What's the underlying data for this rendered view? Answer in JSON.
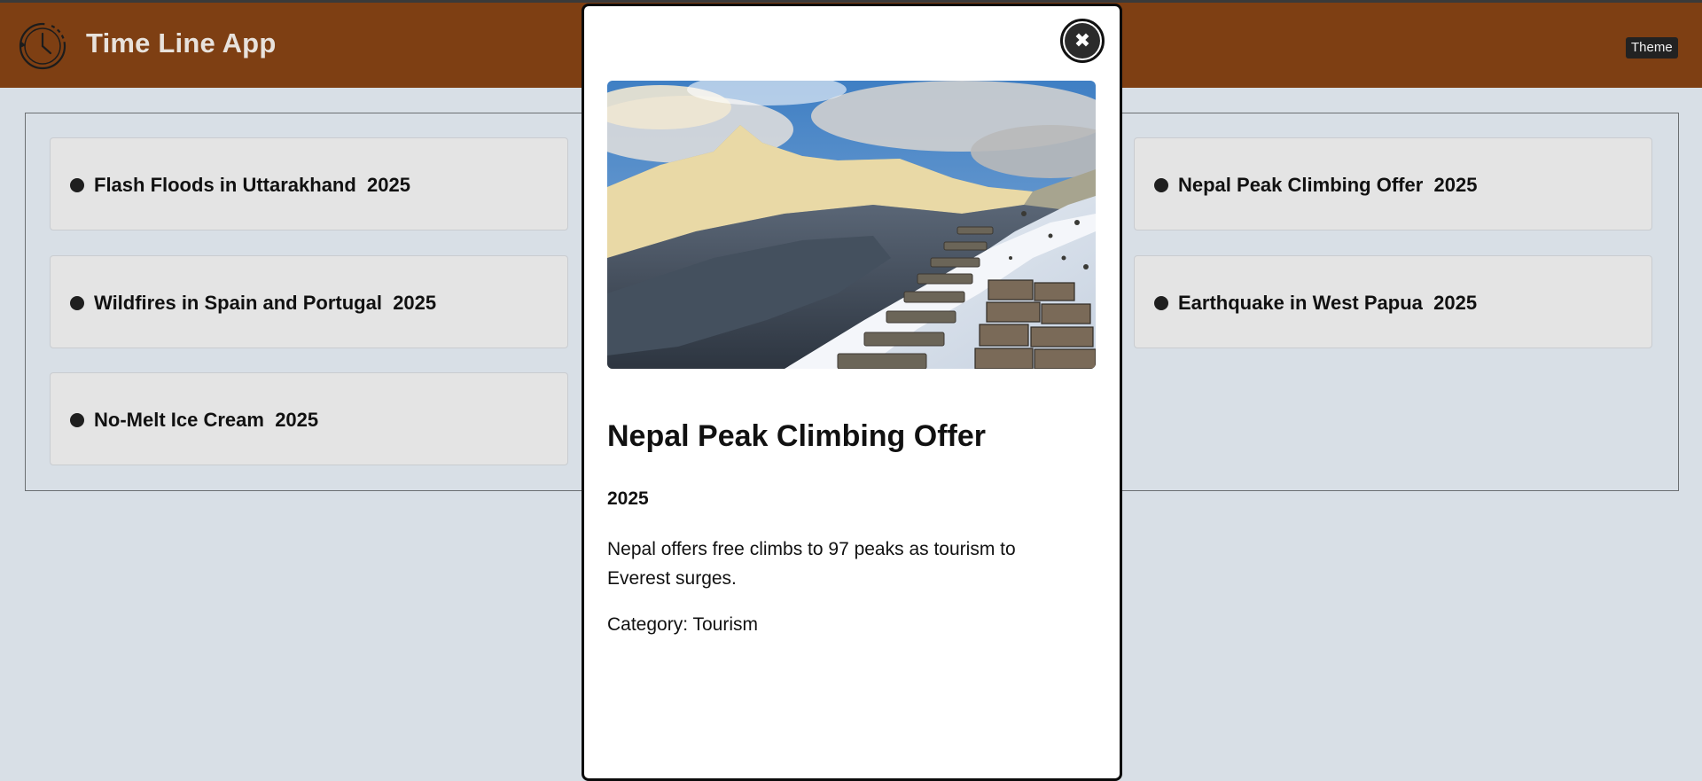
{
  "header": {
    "title": "Time Line App",
    "logo_icon": "history-clock-icon",
    "theme_button": "Theme",
    "background_color": "#7e3f13"
  },
  "events": [
    {
      "title": "Flash Floods in Uttarakhand",
      "year": "2025"
    },
    {
      "title": "Wildfires in Spain and Portugal",
      "year": "2025"
    },
    {
      "title": "No-Melt Ice Cream",
      "year": "2025"
    },
    {
      "title": "Nepal Peak Climbing Offer",
      "year": "2025"
    },
    {
      "title": "Earthquake in West Papua",
      "year": "2025"
    }
  ],
  "modal": {
    "close_icon": "close-icon",
    "image_icon": "mountain-trail-photo",
    "title": "Nepal Peak Climbing Offer",
    "year": "2025",
    "description": "Nepal offers free climbs to 97 peaks as tourism to Everest surges.",
    "category": "Category: Tourism"
  }
}
